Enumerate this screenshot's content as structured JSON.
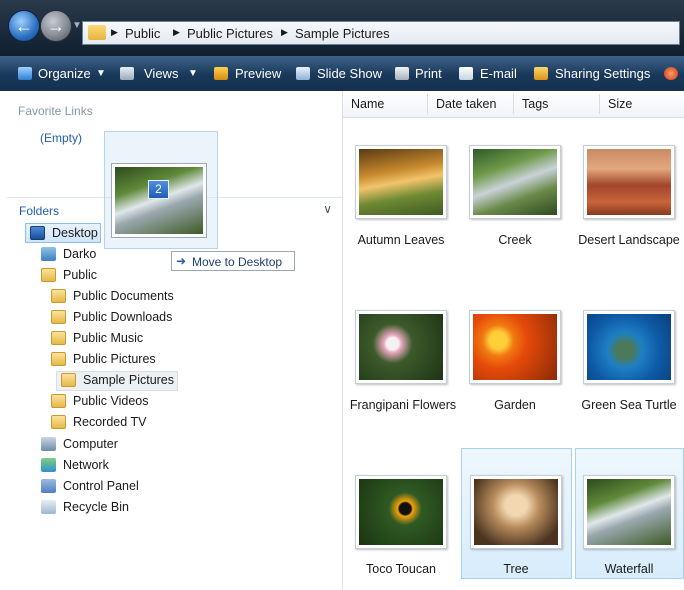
{
  "address": {
    "crumbs": [
      "Public",
      "Public Pictures",
      "Sample Pictures"
    ],
    "icons": {
      "back": "back-arrow-icon",
      "forward": "forward-arrow-icon",
      "folder": "folder-icon"
    }
  },
  "toolbar": {
    "organize": "Organize",
    "views": "Views",
    "preview": "Preview",
    "slideshow": "Slide Show",
    "print": "Print",
    "email": "E-mail",
    "sharing": "Sharing Settings"
  },
  "left": {
    "favorite_links_title": "Favorite Links",
    "favorite_links_empty": "(Empty)",
    "folders_title": "Folders",
    "tree": [
      {
        "label": "Desktop",
        "icon": "desktop-icon"
      },
      {
        "label": "Darko",
        "icon": "user-folder-icon"
      },
      {
        "label": "Public",
        "icon": "folder-icon"
      },
      {
        "label": "Public Documents",
        "icon": "folder-icon"
      },
      {
        "label": "Public Downloads",
        "icon": "folder-icon"
      },
      {
        "label": "Public Music",
        "icon": "music-folder-icon"
      },
      {
        "label": "Public Pictures",
        "icon": "pictures-folder-icon"
      },
      {
        "label": "Sample Pictures",
        "icon": "folder-icon"
      },
      {
        "label": "Public Videos",
        "icon": "videos-folder-icon"
      },
      {
        "label": "Recorded TV",
        "icon": "folder-icon"
      },
      {
        "label": "Computer",
        "icon": "computer-icon"
      },
      {
        "label": "Network",
        "icon": "network-icon"
      },
      {
        "label": "Control Panel",
        "icon": "control-panel-icon"
      },
      {
        "label": "Recycle Bin",
        "icon": "recycle-bin-icon"
      }
    ]
  },
  "drag": {
    "count": "2",
    "tooltip": "Move to Desktop"
  },
  "content": {
    "columns": [
      "Name",
      "Date taken",
      "Tags",
      "Size"
    ],
    "items": [
      {
        "name": "Autumn Leaves"
      },
      {
        "name": "Creek"
      },
      {
        "name": "Desert Landscape"
      },
      {
        "name": "Frangipani Flowers"
      },
      {
        "name": "Garden"
      },
      {
        "name": "Green Sea Turtle"
      },
      {
        "name": "Toco Toucan"
      },
      {
        "name": "Tree"
      },
      {
        "name": "Waterfall"
      }
    ]
  }
}
